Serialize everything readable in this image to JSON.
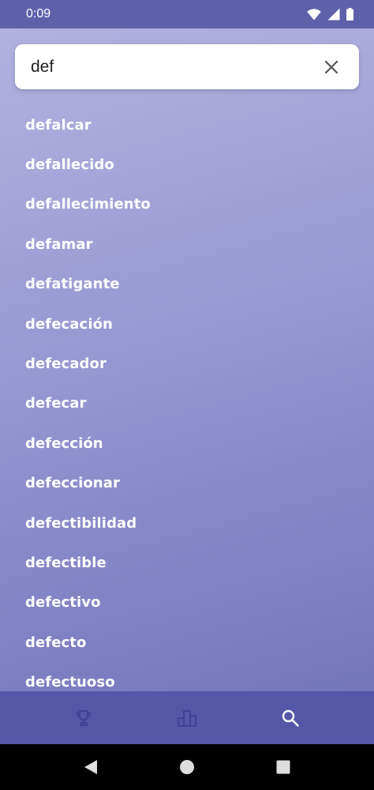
{
  "status_bar": {
    "time": "0:09",
    "icons": [
      "wifi-icon",
      "signal-icon",
      "battery-icon"
    ]
  },
  "search": {
    "value": "def",
    "clear_icon": "close-icon"
  },
  "results": [
    "defalcar",
    "defallecido",
    "defallecimiento",
    "defamar",
    "defatigante",
    "defecación",
    "defecador",
    "defecar",
    "defección",
    "defeccionar",
    "defectibilidad",
    "defectible",
    "defectivo",
    "defecto",
    "defectuoso"
  ],
  "bottom_nav": {
    "items": [
      "trophy-icon",
      "leaderboard-icon",
      "search-icon"
    ],
    "active": "search-icon"
  },
  "system_nav": {
    "items": [
      "back-icon",
      "home-icon",
      "recents-icon"
    ]
  },
  "colors": {
    "status_bar": "#5e60a8",
    "bottom_nav": "#5556a8",
    "nav_inactive": "#3f4096",
    "nav_active": "#ffffff"
  }
}
